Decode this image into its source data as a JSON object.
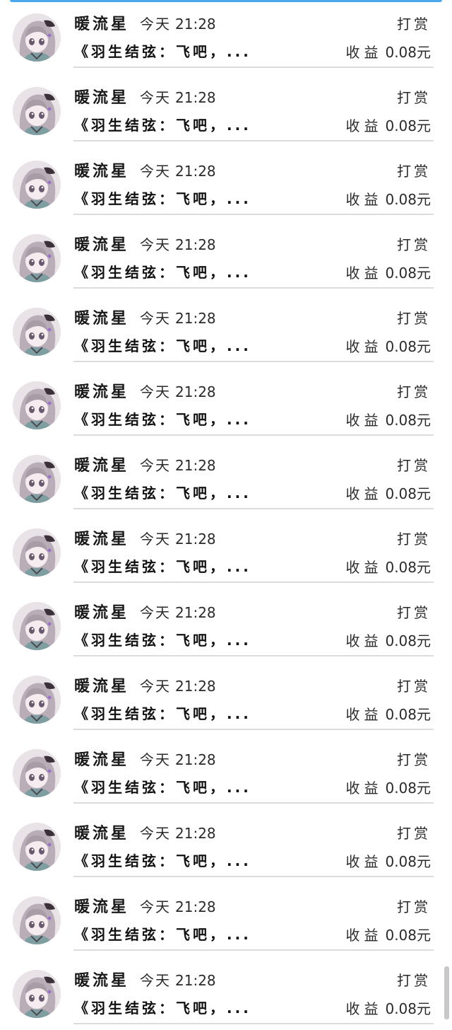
{
  "records": [
    {
      "name": "暖流星",
      "day": "今天",
      "time": "21:28",
      "action": "打赏",
      "work": "《羽生结弦：飞吧，...",
      "earn_label": "收益",
      "amount": "0.08元"
    },
    {
      "name": "暖流星",
      "day": "今天",
      "time": "21:28",
      "action": "打赏",
      "work": "《羽生结弦：飞吧，...",
      "earn_label": "收益",
      "amount": "0.08元"
    },
    {
      "name": "暖流星",
      "day": "今天",
      "time": "21:28",
      "action": "打赏",
      "work": "《羽生结弦：飞吧，...",
      "earn_label": "收益",
      "amount": "0.08元"
    },
    {
      "name": "暖流星",
      "day": "今天",
      "time": "21:28",
      "action": "打赏",
      "work": "《羽生结弦：飞吧，...",
      "earn_label": "收益",
      "amount": "0.08元"
    },
    {
      "name": "暖流星",
      "day": "今天",
      "time": "21:28",
      "action": "打赏",
      "work": "《羽生结弦：飞吧，...",
      "earn_label": "收益",
      "amount": "0.08元"
    },
    {
      "name": "暖流星",
      "day": "今天",
      "time": "21:28",
      "action": "打赏",
      "work": "《羽生结弦：飞吧，...",
      "earn_label": "收益",
      "amount": "0.08元"
    },
    {
      "name": "暖流星",
      "day": "今天",
      "time": "21:28",
      "action": "打赏",
      "work": "《羽生结弦：飞吧，...",
      "earn_label": "收益",
      "amount": "0.08元"
    },
    {
      "name": "暖流星",
      "day": "今天",
      "time": "21:28",
      "action": "打赏",
      "work": "《羽生结弦：飞吧，...",
      "earn_label": "收益",
      "amount": "0.08元"
    },
    {
      "name": "暖流星",
      "day": "今天",
      "time": "21:28",
      "action": "打赏",
      "work": "《羽生结弦：飞吧，...",
      "earn_label": "收益",
      "amount": "0.08元"
    },
    {
      "name": "暖流星",
      "day": "今天",
      "time": "21:28",
      "action": "打赏",
      "work": "《羽生结弦：飞吧，...",
      "earn_label": "收益",
      "amount": "0.08元"
    },
    {
      "name": "暖流星",
      "day": "今天",
      "time": "21:28",
      "action": "打赏",
      "work": "《羽生结弦：飞吧，...",
      "earn_label": "收益",
      "amount": "0.08元"
    },
    {
      "name": "暖流星",
      "day": "今天",
      "time": "21:28",
      "action": "打赏",
      "work": "《羽生结弦：飞吧，...",
      "earn_label": "收益",
      "amount": "0.08元"
    },
    {
      "name": "暖流星",
      "day": "今天",
      "time": "21:28",
      "action": "打赏",
      "work": "《羽生结弦：飞吧，...",
      "earn_label": "收益",
      "amount": "0.08元"
    },
    {
      "name": "暖流星",
      "day": "今天",
      "time": "21:28",
      "action": "打赏",
      "work": "《羽生结弦：飞吧，...",
      "earn_label": "收益",
      "amount": "0.08元"
    }
  ],
  "icons": {
    "avatar": "anime-girl-avatar-icon"
  },
  "colors": {
    "accent": "#4aa8ec",
    "divider": "#dcdcdc",
    "text": "#1a1a1a"
  }
}
